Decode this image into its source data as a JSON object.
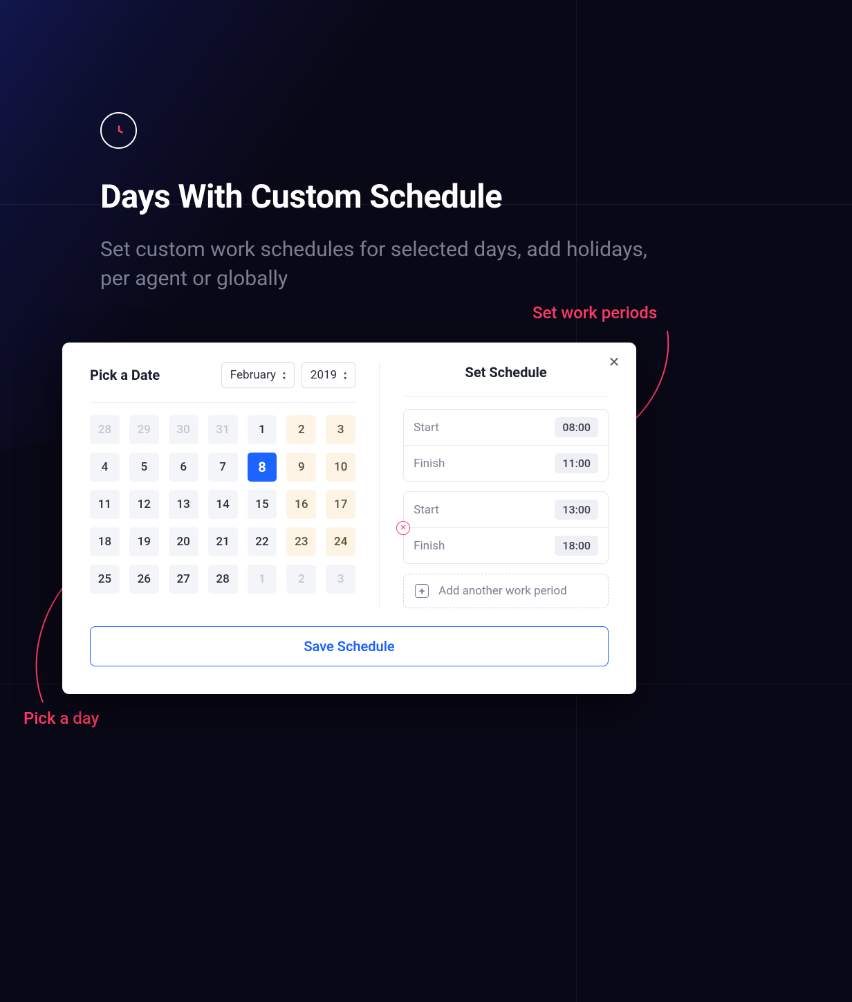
{
  "header": {
    "title": "Days With Custom Schedule",
    "subtitle": "Set custom work schedules for selected days, add holidays, per agent or globally"
  },
  "annotations": {
    "right": "Set work periods",
    "left": "Pick a day"
  },
  "modal": {
    "pick_date_title": "Pick a Date",
    "month": "February",
    "year": "2019",
    "set_schedule_title": "Set Schedule",
    "start_label": "Start",
    "finish_label": "Finish",
    "periods": [
      {
        "start": "08:00",
        "finish": "11:00"
      },
      {
        "start": "13:00",
        "finish": "18:00"
      }
    ],
    "add_period_label": "Add another work period",
    "save_label": "Save Schedule",
    "calendar": [
      {
        "n": "28",
        "t": "muted"
      },
      {
        "n": "29",
        "t": "muted"
      },
      {
        "n": "30",
        "t": "muted"
      },
      {
        "n": "31",
        "t": "muted"
      },
      {
        "n": "1",
        "t": "normal"
      },
      {
        "n": "2",
        "t": "weekend"
      },
      {
        "n": "3",
        "t": "weekend"
      },
      {
        "n": "4",
        "t": "normal"
      },
      {
        "n": "5",
        "t": "normal"
      },
      {
        "n": "6",
        "t": "normal"
      },
      {
        "n": "7",
        "t": "normal"
      },
      {
        "n": "8",
        "t": "selected"
      },
      {
        "n": "9",
        "t": "weekend"
      },
      {
        "n": "10",
        "t": "weekend"
      },
      {
        "n": "11",
        "t": "normal"
      },
      {
        "n": "12",
        "t": "normal"
      },
      {
        "n": "13",
        "t": "normal"
      },
      {
        "n": "14",
        "t": "normal"
      },
      {
        "n": "15",
        "t": "normal"
      },
      {
        "n": "16",
        "t": "weekend"
      },
      {
        "n": "17",
        "t": "weekend"
      },
      {
        "n": "18",
        "t": "normal"
      },
      {
        "n": "19",
        "t": "normal"
      },
      {
        "n": "20",
        "t": "normal"
      },
      {
        "n": "21",
        "t": "normal"
      },
      {
        "n": "22",
        "t": "normal"
      },
      {
        "n": "23",
        "t": "weekend"
      },
      {
        "n": "24",
        "t": "weekend"
      },
      {
        "n": "25",
        "t": "normal"
      },
      {
        "n": "26",
        "t": "normal"
      },
      {
        "n": "27",
        "t": "normal"
      },
      {
        "n": "28",
        "t": "normal"
      },
      {
        "n": "1",
        "t": "muted"
      },
      {
        "n": "2",
        "t": "muted"
      },
      {
        "n": "3",
        "t": "muted"
      }
    ]
  },
  "colors": {
    "accent_blue": "#1d63ff",
    "accent_pink": "#ff3a66"
  }
}
